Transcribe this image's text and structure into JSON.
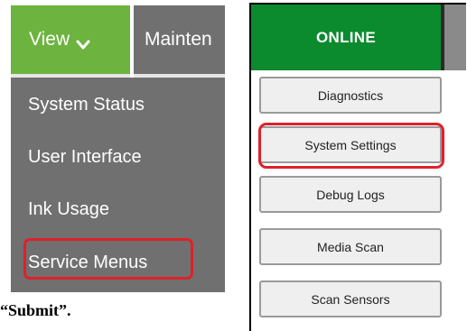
{
  "menubar": {
    "view_label": "View",
    "view_icon": "chevron-down-icon",
    "maintenance_label": "Mainten"
  },
  "view_menu": {
    "items": [
      {
        "label": "System Status"
      },
      {
        "label": "User Interface"
      },
      {
        "label": "Ink Usage"
      },
      {
        "label": "Service Menus",
        "highlighted": true
      }
    ]
  },
  "online_panel": {
    "tab_label": "ONLINE",
    "buttons": [
      {
        "label": "Diagnostics"
      },
      {
        "label": "System Settings",
        "highlighted": true
      },
      {
        "label": "Debug Logs"
      },
      {
        "label": "Media Scan"
      },
      {
        "label": "Scan Sensors"
      }
    ]
  },
  "caption": {
    "text": "“Submit”."
  },
  "colors": {
    "view_tab_green": "#6db33f",
    "menu_gray": "#707070",
    "online_green": "#0b8a2e",
    "highlight_red": "#e0202a",
    "button_fill": "#efefef"
  }
}
